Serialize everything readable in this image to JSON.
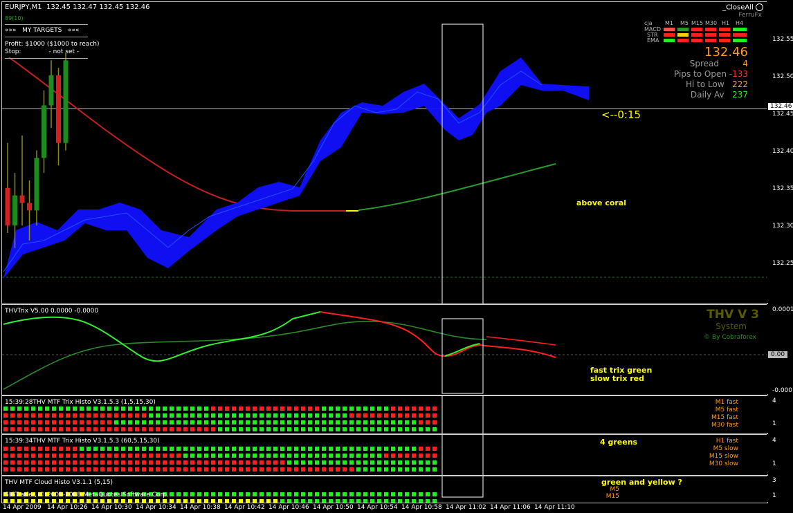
{
  "symbol_header": "EURJPY,M1  132.45 132.47 132.45 132.46",
  "close_all": "_CloseAll",
  "ferrufx": "FerruFx",
  "targets": {
    "small_num": "89(10)",
    "title": "»»»   MY TARGETS   «««",
    "profit": "Profit: $1000 ($1000 to reach)",
    "stop": "Stop:              - not set -"
  },
  "panel": {
    "cols": [
      "cja",
      "M1",
      "M5",
      "M15",
      "M30",
      "H1",
      "H4"
    ],
    "rows": [
      "MACD",
      "STR",
      "EMA"
    ],
    "price": "132.46",
    "spread_label": "Spread",
    "spread_value": "4",
    "pips_label": "Pips to Open",
    "pips_value": "-133",
    "hilo_label": "Hi to Low",
    "hilo_value": "222",
    "daily_label": "Daily Av",
    "daily_value": "237",
    "timer": "<--0:15"
  },
  "annotations": {
    "above_coral": "above coral",
    "fast_trix": "fast trix green",
    "slow_trix": "slow trix red",
    "four_greens": "4 greens",
    "green_yellow": "green and yellow ?"
  },
  "thv": {
    "title": "THV V 3",
    "system": "System",
    "by": "© By Cobraforex"
  },
  "indicators": {
    "trix_header": "THVTrix V5.00 0.0000 -0.0000",
    "histo1_header": "15:39:28THV MTF Trix Histo V3.1.5.3 (1,5,15,30)",
    "histo2_header": "15:39:34THV MTF Trix Histo V3.1.5.3 (60,5,15,30)",
    "cloud_header": "THV MTF Cloud Histo V3.1.1 (5,15)",
    "copyright": "SIGTrader, © 2001-2008 MetaQuotes Software Corp.",
    "histo1_labels": [
      "M1 fast",
      "M5 fast",
      "M15 fast",
      "M30 fast"
    ],
    "histo2_labels": [
      "H1 fast",
      "M5 slow",
      "M15 slow",
      "M30 slow"
    ],
    "cloud_labels": [
      "M5",
      "M15"
    ]
  },
  "main_axis": [
    "132.55",
    "132.50",
    "132.46",
    "132.45",
    "132.40",
    "132.35",
    "132.30",
    "132.25"
  ],
  "trix_axis": [
    "0.0001",
    "0.00",
    "-0.0001"
  ],
  "histo1_axis": [
    "4",
    "1"
  ],
  "histo2_axis": [
    "4",
    "1"
  ],
  "cloud_axis": [
    "3",
    "1"
  ],
  "time_axis": [
    "14 Apr 2009",
    "14 Apr 10:26",
    "14 Apr 10:30",
    "14 Apr 10:34",
    "14 Apr 10:38",
    "14 Apr 10:42",
    "14 Apr 10:46",
    "14 Apr 10:50",
    "14 Apr 10:54",
    "14 Apr 10:58",
    "14 Apr 11:02",
    "14 Apr 11:06",
    "14 Apr 11:10"
  ],
  "colors": {
    "up": "#1f8a1f",
    "down": "#d02020",
    "cloud": "#1010ff",
    "ma": "#c02020",
    "ma2": "#2a9a2a",
    "accent": "#ffff00",
    "orange": "#ff9a1a"
  },
  "chart_data": {
    "type": "candlestick",
    "candles": [
      {
        "o": 132.35,
        "h": 132.41,
        "l": 132.29,
        "c": 132.3
      },
      {
        "o": 132.3,
        "h": 132.37,
        "l": 132.27,
        "c": 132.34
      },
      {
        "o": 132.34,
        "h": 132.42,
        "l": 132.3,
        "c": 132.33
      },
      {
        "o": 132.33,
        "h": 132.36,
        "l": 132.28,
        "c": 132.32
      },
      {
        "o": 132.32,
        "h": 132.4,
        "l": 132.3,
        "c": 132.39
      },
      {
        "o": 132.39,
        "h": 132.48,
        "l": 132.37,
        "c": 132.46
      },
      {
        "o": 132.46,
        "h": 132.52,
        "l": 132.43,
        "c": 132.5
      },
      {
        "o": 132.5,
        "h": 132.51,
        "l": 132.38,
        "c": 132.41
      },
      {
        "o": 132.41,
        "h": 132.53,
        "l": 132.4,
        "c": 132.52
      }
    ]
  }
}
